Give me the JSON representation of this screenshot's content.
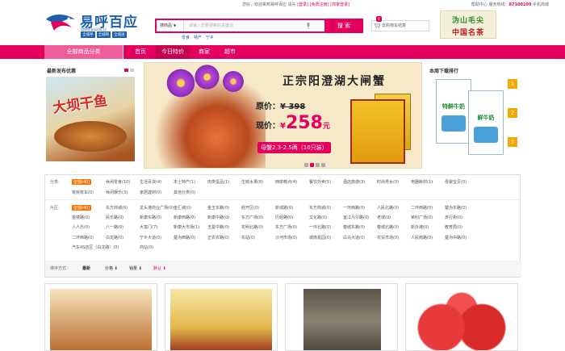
{
  "topbar": {
    "welcome": "您好，欢迎来到易呼百应",
    "login": "请先",
    "login_link": "[登录]",
    "register_link": "[免费注册]",
    "business": "[商家登录]",
    "help_center": "帮助中心",
    "service_phone_label": "服务热线：",
    "service_phone": "87100100",
    "mobile": "手机商城"
  },
  "logo": {
    "name": "易呼百应",
    "url": "WWW.bai100.cn",
    "tags": [
      "全城呼",
      "全城购",
      "全城送"
    ]
  },
  "search": {
    "scope": "搜商品",
    "placeholder": "请输入您要搜索的关键词",
    "button": "搜 索",
    "hot_words": [
      "零食",
      "特产",
      "宁乡"
    ]
  },
  "cart": {
    "count": "0",
    "label": "去购物车结算"
  },
  "tea_ad": {
    "line1": "沩山毛尖",
    "line2": "中国名茶"
  },
  "nav": {
    "all_categories": "全部商品分类",
    "items": [
      "首页",
      "今日特价",
      "商家",
      "超市"
    ],
    "active_index": 1
  },
  "promo": {
    "title": "最新发布优惠",
    "image_text": "大坝干鱼"
  },
  "banner": {
    "headline": "正宗阳澄湖大闸蟹",
    "original_label": "原价：",
    "original_price": "¥ 398",
    "now_label": "现价：",
    "now_currency": "¥",
    "now_price": "258",
    "now_unit": "元",
    "spec": "母蟹2.3-2.5两（10只装）"
  },
  "ranking": {
    "title": "本周下载排行",
    "product": "特鲜牛奶",
    "product2": "鲜牛奶",
    "ranks": [
      "1",
      "2",
      "3"
    ]
  },
  "filters": {
    "category_label": "分类：",
    "categories": [
      "全部(40)",
      "休闲零食(10)",
      "生活百货(4)",
      "本土特产(1)",
      "肉类蛋品(1)",
      "生鲜水果(8)",
      "西饼糕点(4)",
      "餐饮外卖(5)",
      "酒店旅游(3)",
      "时尚男女(0)",
      "电器耗材(1)",
      "母婴宝贝(0)",
      "有房有车(0)",
      "休闲娱乐(3)",
      "家居建材(0)",
      "其他分类(0)"
    ],
    "area_label": "片区：",
    "areas": [
      "全部(40)",
      "东方商城(6)",
      "龙头港商业广场(0)",
      "金汇城(0)",
      "金玉东路(0)",
      "经开区(0)",
      "新城路(0)",
      "东方商城(0)",
      "一环西路(0)",
      "人民北路(0)",
      "二环西路(0)",
      "楚沩东路(0)",
      "金楼路(0)",
      "民乐路(0)",
      "新康东路(0)",
      "新康西路(0)",
      "新康中路(0)",
      "东方广场(0)",
      "历经路(0)",
      "文化路(0)",
      "宜江凡尔路(0)",
      "老城(0)",
      "荣利广场(0)",
      "步行街(0)",
      "人人乐(0)",
      "八一路(0)",
      "大富门(7)",
      "新康大市场(1)",
      "玉曼中路(0)",
      "花明北路(0)",
      "东方广场(0)",
      "一环北路(0)",
      "春城东路(0)",
      "春城北路(0)",
      "新外滩(0)",
      "教育局(0)",
      "二环西路(0)",
      "白龙路(0)",
      "宁乡大道(0)",
      "楚沩西路(0)",
      "正农农路(0)",
      "东站(0)",
      "沙河市场(0)",
      "城南嘉园(0)",
      "白马大道(0)",
      "农贸市场(0)",
      "人民南路(0)",
      "楚沩中路(0)",
      "汽车4S店区（白龙路）(0)",
      "商站(0)"
    ],
    "sort_label": "排序方式：",
    "sorts": [
      "最新",
      "价格 ⬇",
      "销量 ⬇",
      "默认 ⬇"
    ]
  },
  "colors": {
    "brand_pink": "#e5005f",
    "logo_blue": "#1b5fae",
    "filter_orange": "#ff7000"
  }
}
